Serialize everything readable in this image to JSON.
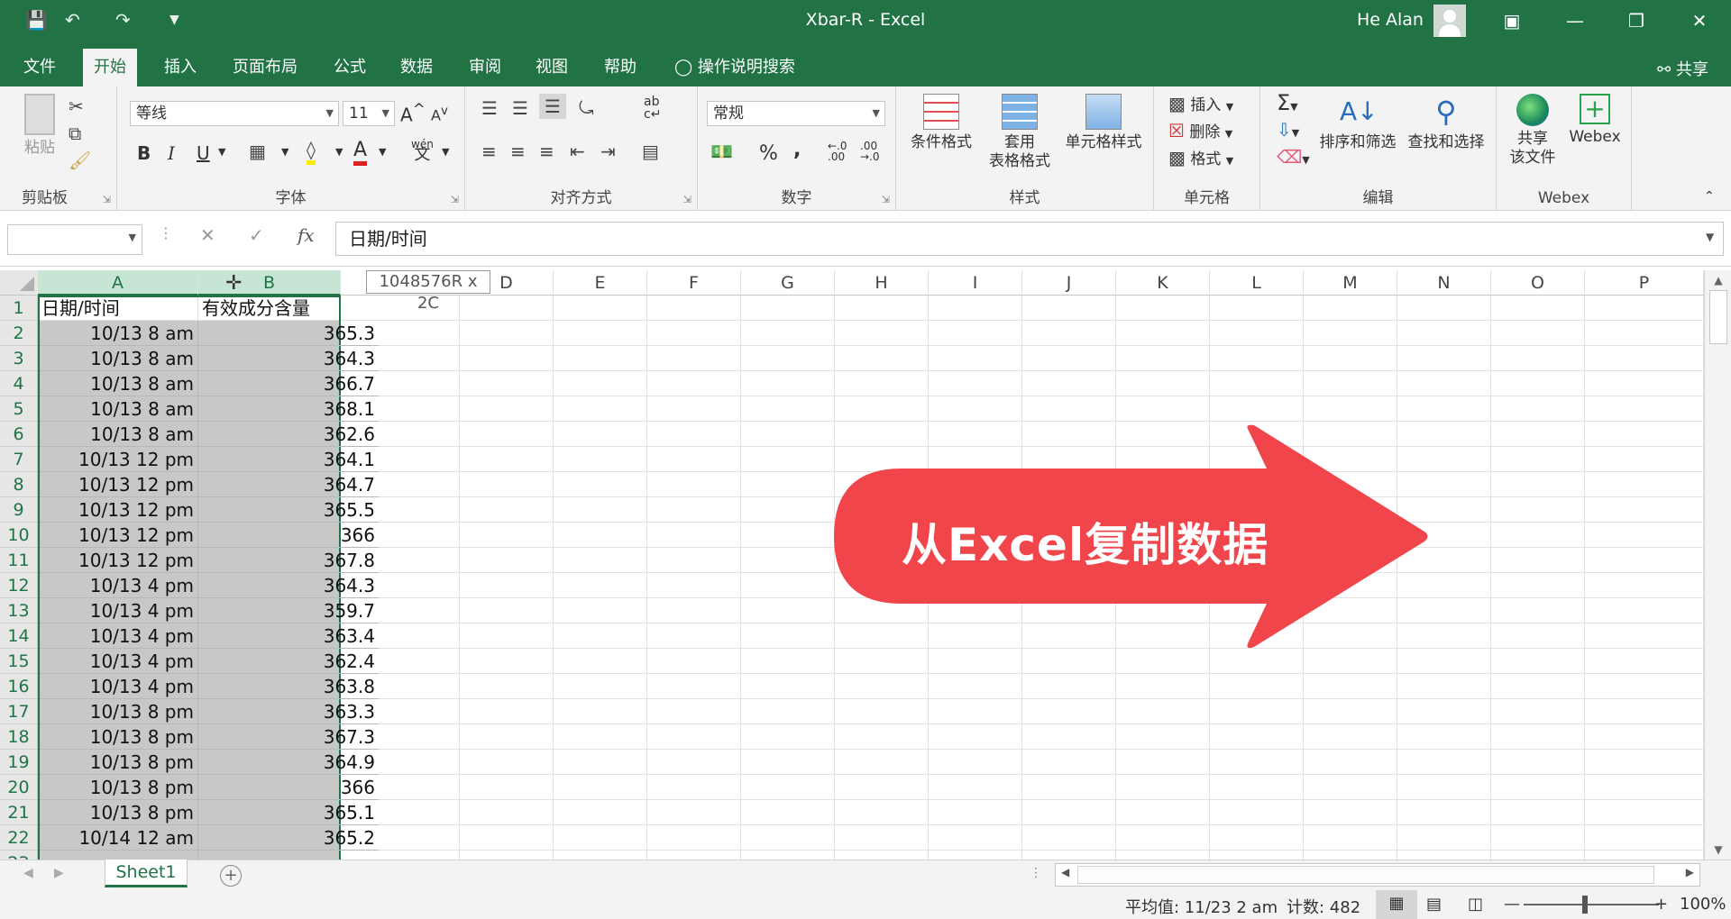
{
  "titlebar": {
    "title": "Xbar-R  -  Excel",
    "user": "He Alan",
    "qa_icons": [
      "save-icon",
      "undo-icon",
      "redo-icon",
      "customize-icon"
    ],
    "window_buttons": [
      "ribbon-display-icon",
      "minimize-icon",
      "restore-icon",
      "close-icon"
    ]
  },
  "menu": {
    "tabs": [
      "文件",
      "开始",
      "插入",
      "页面布局",
      "公式",
      "数据",
      "审阅",
      "视图",
      "帮助"
    ],
    "active": "开始",
    "tell_me": "操作说明搜索",
    "share": "共享"
  },
  "ribbon": {
    "clipboard": {
      "paste": "粘贴",
      "label": "剪贴板"
    },
    "font": {
      "name": "等线",
      "size": "11",
      "bold": "B",
      "italic": "I",
      "underline": "U",
      "label": "字体",
      "grow": "A",
      "shrink": "A",
      "phonetic": "wén"
    },
    "alignment": {
      "label": "对齐方式"
    },
    "number": {
      "format": "常规",
      "percent": "%",
      "comma": ",",
      "label": "数字"
    },
    "styles": {
      "conditional": "条件格式",
      "table_line1": "套用",
      "table_line2": "表格格式",
      "cell_styles": "单元格样式",
      "label": "样式"
    },
    "cells": {
      "insert": "插入",
      "delete": "删除",
      "format": "格式",
      "label": "单元格"
    },
    "editing": {
      "sort": "排序和筛选",
      "find": "查找和选择",
      "label": "编辑"
    },
    "webex": {
      "share_line1": "共享",
      "share_line2": "该文件",
      "webex": "Webex",
      "label": "Webex"
    }
  },
  "formula_bar": {
    "name_box": "",
    "fx": "fx",
    "content": "日期/时间"
  },
  "grid": {
    "columns": [
      "A",
      "B",
      "C",
      "D",
      "E",
      "F",
      "G",
      "H",
      "I",
      "J",
      "K",
      "L",
      "M",
      "N",
      "O",
      "P"
    ],
    "selected_columns": [
      "A",
      "B"
    ],
    "selection_tip": "1048576R x 2C",
    "headers": [
      "日期/时间",
      "有效成分含量"
    ],
    "rows": [
      [
        "10/13 8 am",
        "365.3"
      ],
      [
        "10/13 8 am",
        "364.3"
      ],
      [
        "10/13 8 am",
        "366.7"
      ],
      [
        "10/13 8 am",
        "368.1"
      ],
      [
        "10/13 8 am",
        "362.6"
      ],
      [
        "10/13 12 pm",
        "364.1"
      ],
      [
        "10/13 12 pm",
        "364.7"
      ],
      [
        "10/13 12 pm",
        "365.5"
      ],
      [
        "10/13 12 pm",
        "366"
      ],
      [
        "10/13 12 pm",
        "367.8"
      ],
      [
        "10/13 4 pm",
        "364.3"
      ],
      [
        "10/13 4 pm",
        "359.7"
      ],
      [
        "10/13 4 pm",
        "363.4"
      ],
      [
        "10/13 4 pm",
        "362.4"
      ],
      [
        "10/13 4 pm",
        "363.8"
      ],
      [
        "10/13 8 pm",
        "363.3"
      ],
      [
        "10/13 8 pm",
        "367.3"
      ],
      [
        "10/13 8 pm",
        "364.9"
      ],
      [
        "10/13 8 pm",
        "366"
      ],
      [
        "10/13 8 pm",
        "365.1"
      ],
      [
        "10/14 12 am",
        "365.2"
      ]
    ]
  },
  "overlay": {
    "text": "从Excel复制数据",
    "color": "#f0454b"
  },
  "sheets": {
    "tabs": [
      "Sheet1"
    ],
    "active": "Sheet1",
    "add": "+"
  },
  "status": {
    "average": "平均值: 11/23 2 am",
    "count": "计数: 482",
    "zoom": "100%"
  },
  "colors": {
    "excel_green": "#217346",
    "selection_gray": "#c8c8c8",
    "ribbon_bg": "#f3f3f3"
  }
}
